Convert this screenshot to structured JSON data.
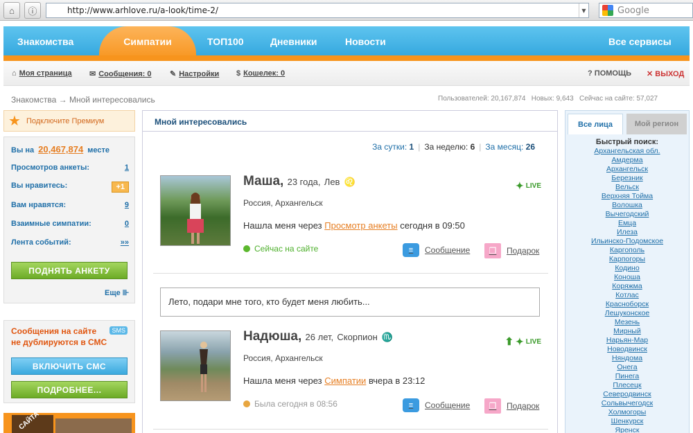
{
  "browser": {
    "url": "http://www.arhlove.ru/a-look/time-2/",
    "search_placeholder": "Google"
  },
  "topnav": {
    "items": [
      "Знакомства",
      "Симпатии",
      "ТОП100",
      "Дневники",
      "Новости"
    ],
    "active": "Симпатии",
    "services": "Все сервисы"
  },
  "subnav": {
    "my_page": "Моя страница",
    "messages": "Сообщения: 0",
    "settings": "Настройки",
    "wallet": "Кошелек: 0",
    "help": "ПОМОЩЬ",
    "exit": "ВЫХОД"
  },
  "breadcrumb": {
    "root": "Знакомства",
    "arrow": "→",
    "current": "Мной интересовались"
  },
  "site_stats": "Пользователей: 20,167,874   Новых: 9,643   Сейчас на сайте: 57,027",
  "left": {
    "premium": "Подключите Премиум",
    "rank_pre": "Вы на",
    "rank": "20,467,874",
    "rank_post": "месте",
    "rows": [
      {
        "label": "Просмотров анкеты:",
        "value": "1"
      },
      {
        "label": "Вы нравитесь:",
        "value": "+1"
      },
      {
        "label": "Вам нравятся:",
        "value": "9"
      },
      {
        "label": "Взаимные симпатии:",
        "value": "0"
      },
      {
        "label": "Лента событий:",
        "value": "»»"
      }
    ],
    "raise_button": "ПОДНЯТЬ АНКЕТУ",
    "more": "Еще",
    "sms_text_1": "Сообщения на сайте",
    "sms_text_2": "не дублируются в СМС",
    "sms_badge": "SMS",
    "sms_button": "ВКЛЮЧИТЬ СМС",
    "details_button": "ПОДРОБНЕЕ...",
    "promo_text": "САЙТА"
  },
  "main": {
    "title": "Мной интересовались",
    "periods": [
      {
        "label": "За сутки:",
        "value": "1"
      },
      {
        "label": "За неделю:",
        "value": "6"
      },
      {
        "label": "За месяц:",
        "value": "26"
      }
    ],
    "live_label": "LIVE",
    "message_label": "Сообщение",
    "gift_label": "Подарок",
    "profiles": [
      {
        "name": "Маша,",
        "age": "23 года,",
        "sign": "Лев",
        "sign_icon": "♌",
        "location": "Россия, Архангельск",
        "found_pre": "Нашла меня через",
        "found_link": "Просмотр анкеты",
        "found_post": "сегодня в 09:50",
        "status": "Сейчас на сайте",
        "status_color": "#4caf2a",
        "dot_color": "#5cb82e"
      },
      {
        "name": "Надюша,",
        "age": "26 лет,",
        "sign": "Скорпион",
        "sign_icon": "♏",
        "location": "Россия, Архангельск",
        "found_pre": "Нашла меня через",
        "found_link": "Симпатии",
        "found_post": "вчера в 23:12",
        "status": "Была сегодня в 08:56",
        "status_color": "#999999",
        "dot_color": "#e8a640"
      }
    ],
    "quote": "Лето, подари мне того, кто будет меня любить..."
  },
  "right": {
    "tab_active": "Все лица",
    "tab_inactive": "Мой регион",
    "quick_search": "Быстрый поиск:",
    "cities": [
      "Архангельская обл.",
      "Амдерма",
      "Архангельск",
      "Березник",
      "Вельск",
      "Верхняя Тойма",
      "Волошка",
      "Вычегодский",
      "Емца",
      "Илеза",
      "Ильинско-Подомское",
      "Каргополь",
      "Карпогоры",
      "Кодино",
      "Коноша",
      "Коряжма",
      "Котлас",
      "Красноборск",
      "Лешуконское",
      "Мезень",
      "Мирный",
      "Нарьян-Мар",
      "Новодвинск",
      "Няндома",
      "Онега",
      "Пинега",
      "Плесецк",
      "Северодвинск",
      "Сольвычегодск",
      "Холмогоры",
      "Шенкурск",
      "Яренск"
    ]
  }
}
